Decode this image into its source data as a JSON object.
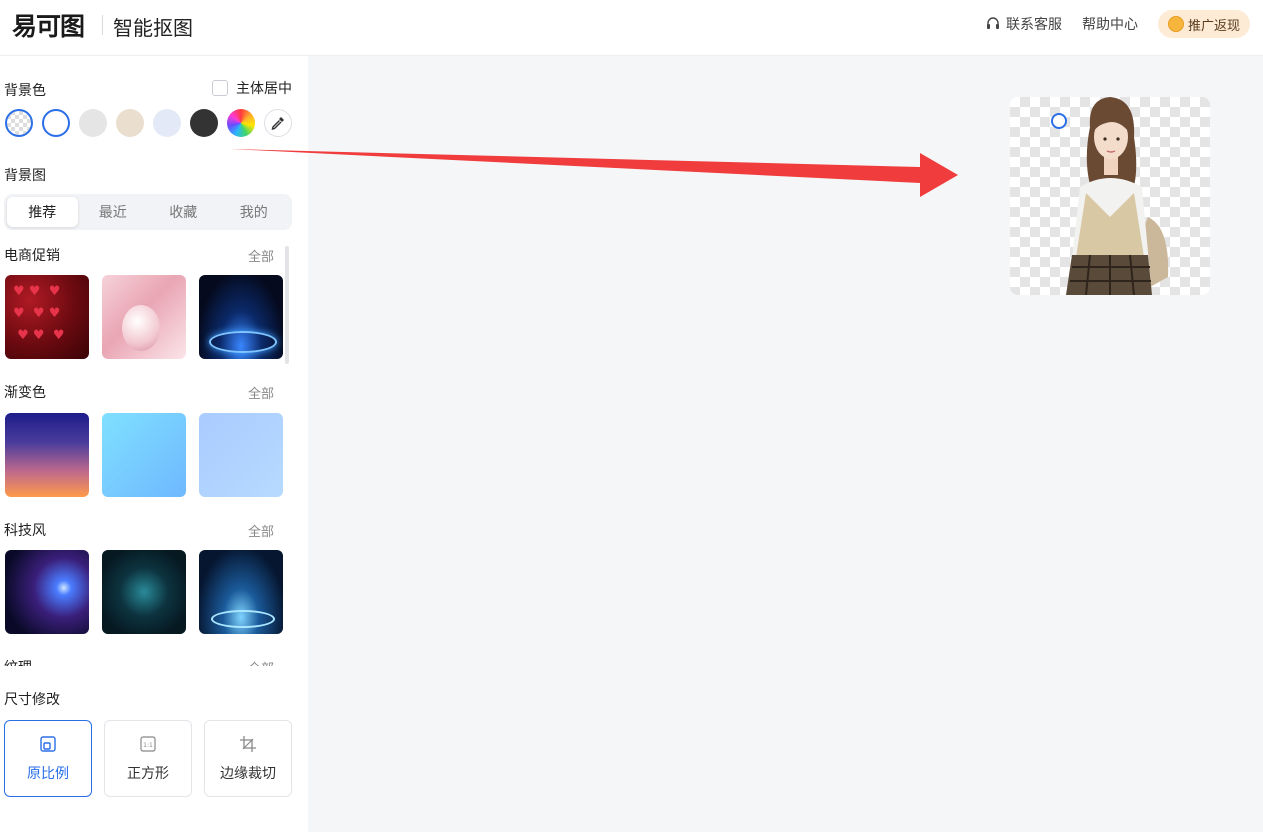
{
  "header": {
    "logo": "易可图",
    "title": "智能抠图",
    "links": [
      {
        "label": "联系客服",
        "icon": "headset-icon"
      },
      {
        "label": "帮助中心",
        "icon": ""
      }
    ],
    "promo_label": "推广返现"
  },
  "sidebar": {
    "bg_color_label": "背景色",
    "center_subject_label": "主体居中",
    "swatches": [
      {
        "name": "transparent",
        "color": "transparent"
      },
      {
        "name": "white",
        "color": "#ffffff"
      },
      {
        "name": "light-gray",
        "color": "#e5e5e5"
      },
      {
        "name": "beige",
        "color": "#eadfcf"
      },
      {
        "name": "light-blue",
        "color": "#e3e9f6"
      },
      {
        "name": "dark",
        "color": "#333333"
      },
      {
        "name": "custom-color",
        "color": "rainbow"
      },
      {
        "name": "eyedropper",
        "color": "#ffffff"
      }
    ],
    "bg_image_label": "背景图",
    "tabs": [
      "推荐",
      "最近",
      "收藏",
      "我的"
    ],
    "active_tab": "推荐",
    "see_all": "全部",
    "categories": [
      {
        "label": "电商促销"
      },
      {
        "label": "渐变色"
      },
      {
        "label": "科技风"
      },
      {
        "label": "纹理"
      }
    ],
    "size_label": "尺寸修改",
    "size_options": [
      "原比例",
      "正方形",
      "边缘裁切"
    ],
    "active_size": "原比例"
  },
  "colors": {
    "accent": "#2b6fe8",
    "arrow": "#f03c3c",
    "promo_bg": "#fdebd6"
  }
}
